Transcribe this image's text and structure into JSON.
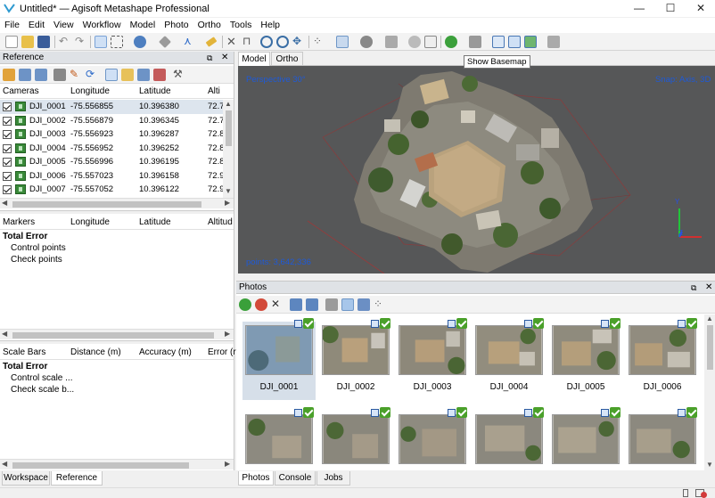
{
  "window": {
    "title": "Untitled* — Agisoft Metashape Professional",
    "min": "—",
    "max": "☐",
    "close": "✕"
  },
  "menu": [
    "File",
    "Edit",
    "View",
    "Workflow",
    "Model",
    "Photo",
    "Ortho",
    "Tools",
    "Help"
  ],
  "tooltip": "Show Basemap",
  "reference": {
    "title": "Reference",
    "cameras": {
      "headers": [
        "Cameras",
        "Longitude",
        "Latitude",
        "Alti"
      ],
      "rows": [
        {
          "name": "DJI_0001",
          "lon": "-75.556855",
          "lat": "10.396380",
          "alt": "72.7"
        },
        {
          "name": "DJI_0002",
          "lon": "-75.556879",
          "lat": "10.396345",
          "alt": "72.7"
        },
        {
          "name": "DJI_0003",
          "lon": "-75.556923",
          "lat": "10.396287",
          "alt": "72.8"
        },
        {
          "name": "DJI_0004",
          "lon": "-75.556952",
          "lat": "10.396252",
          "alt": "72.8"
        },
        {
          "name": "DJI_0005",
          "lon": "-75.556996",
          "lat": "10.396195",
          "alt": "72.8"
        },
        {
          "name": "DJI_0006",
          "lon": "-75.557023",
          "lat": "10.396158",
          "alt": "72.9"
        },
        {
          "name": "DJI_0007",
          "lon": "-75.557052",
          "lat": "10.396122",
          "alt": "72.9"
        }
      ]
    },
    "markers": {
      "headers": [
        "Markers",
        "Longitude",
        "Latitude",
        "Altitud"
      ],
      "total": "Total Error",
      "items": [
        "Control points",
        "Check points"
      ]
    },
    "scalebars": {
      "headers": [
        "Scale Bars",
        "Distance (m)",
        "Accuracy (m)",
        "Error (r"
      ],
      "total": "Total Error",
      "items": [
        "Control scale ...",
        "Check scale b..."
      ]
    }
  },
  "left_tabs": [
    "Workspace",
    "Reference"
  ],
  "view_tabs": [
    "Model",
    "Ortho"
  ],
  "viewport": {
    "perspective": "Perspective 30°",
    "snap": "Snap: Axis, 3D",
    "points": "points: 3,642,336",
    "axis_y": "Y",
    "axis_z": "Z"
  },
  "photos": {
    "title": "Photos",
    "labels": [
      "DJI_0001",
      "DJI_0002",
      "DJI_0003",
      "DJI_0004",
      "DJI_0005",
      "DJI_0006"
    ]
  },
  "bottom_tabs": [
    "Photos",
    "Console",
    "Jobs"
  ],
  "colors": {
    "accent": "#3a6ea5",
    "viewport_bg": "#565758",
    "perspective_text": "#1e5ad8",
    "check_green": "#4aa02a"
  }
}
